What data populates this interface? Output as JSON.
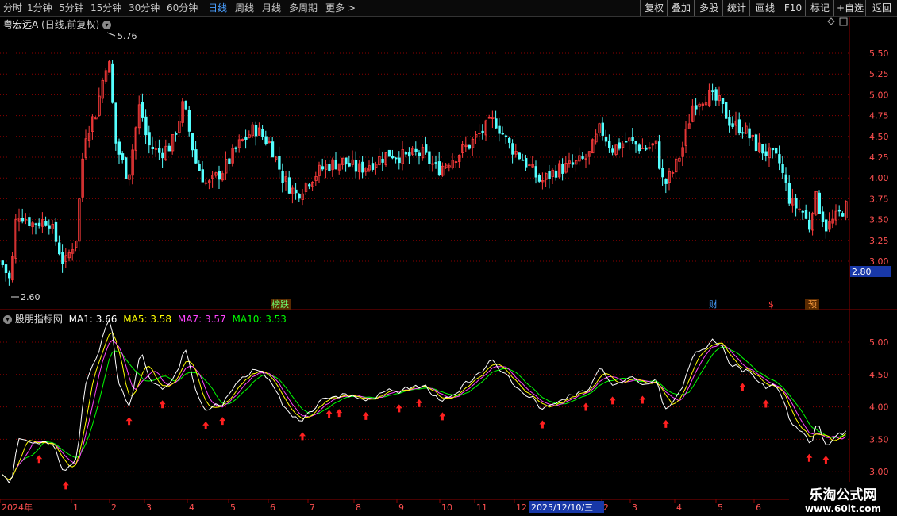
{
  "toolbar": {
    "periods": [
      "分时",
      "1分钟",
      "5分钟",
      "15分钟",
      "30分钟",
      "60分钟",
      "日线",
      "周线",
      "月线",
      "多周期",
      "更多"
    ],
    "active_period": "日线",
    "right_buttons": [
      "复权",
      "叠加",
      "多股",
      "统计",
      "画线",
      "F10",
      "标记",
      "+自选",
      "返回"
    ]
  },
  "main_chart": {
    "stock_title": "粤宏远A",
    "mode": "(日线,前复权)",
    "high_marker": "5.76",
    "low_marker": "2.60",
    "price_axis": [
      "5.50",
      "5.25",
      "5.00",
      "4.75",
      "4.50",
      "4.25",
      "4.00",
      "3.75",
      "3.50",
      "3.25",
      "3.00"
    ],
    "price_tag": "2.80",
    "event_labels": [
      "榜跌",
      "财",
      "$",
      "预"
    ]
  },
  "indicator": {
    "name": "股朋指标网",
    "ma1_label": "MA1: 3.66",
    "ma5_label": "MA5: 3.58",
    "ma7_label": "MA7: 3.57",
    "ma10_label": "MA10: 3.53",
    "axis": [
      "5.00",
      "4.50",
      "4.00",
      "3.50",
      "3.00"
    ]
  },
  "time_axis": {
    "labels": [
      "2024年",
      "1",
      "2",
      "3",
      "4",
      "5",
      "6",
      "7",
      "8",
      "9",
      "10",
      "11",
      "12",
      "2",
      "3",
      "4",
      "5",
      "6"
    ],
    "cursor_date": "2025/12/10/三"
  },
  "watermark": {
    "name": "乐淘公式网",
    "url": "www.60lt.com"
  },
  "colors": {
    "up": "#ff3c3c",
    "down": "#54ffff",
    "ma1": "#ffffff",
    "ma5": "#ffff00",
    "ma7": "#ff44ff",
    "ma10": "#00ff00",
    "grid": "#8b0000",
    "active_tab": "#4a9fff"
  }
}
